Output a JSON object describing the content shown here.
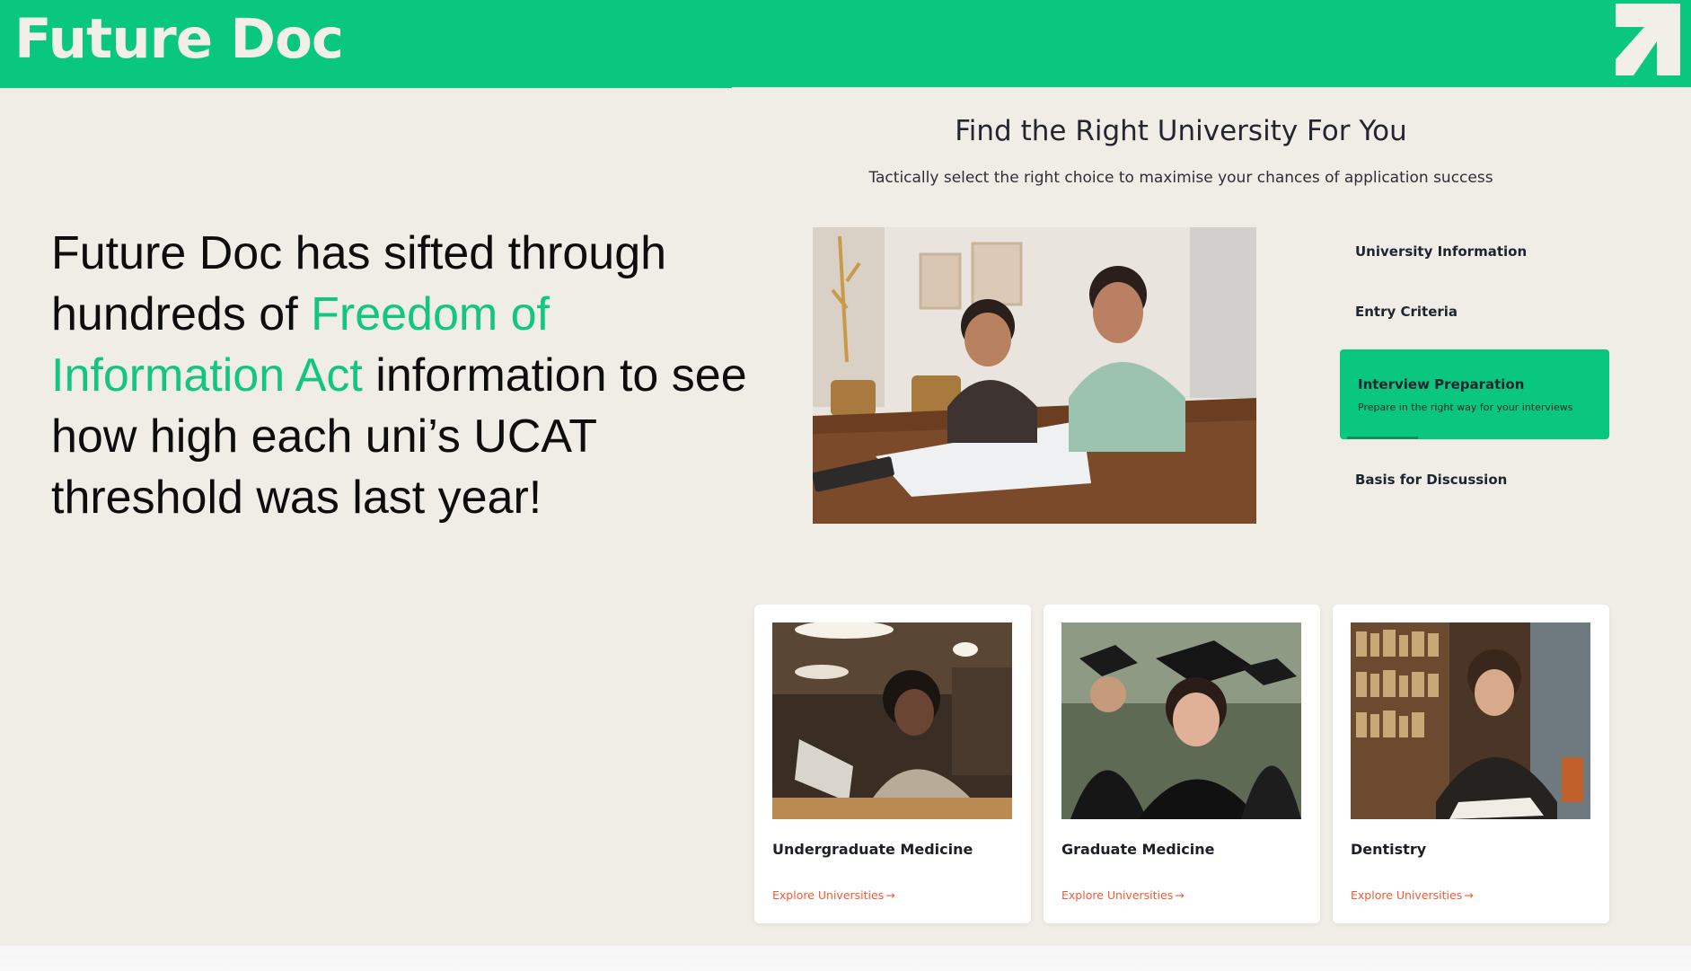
{
  "header": {
    "brand": "Future Doc",
    "logo_icon": "arrow-up-right-icon"
  },
  "hero": {
    "part1": "Future Doc has sifted through hundreds of ",
    "accent": "Freedom of Information Act",
    "part2": " information to see how high each uni’s UCAT threshold was last year!"
  },
  "section": {
    "title": "Find the Right University For You",
    "subtitle": "Tactically select the right choice to maximise your chances of application success"
  },
  "menu": {
    "items": [
      {
        "label": "University Information"
      },
      {
        "label": "Entry Criteria"
      },
      {
        "label": "Interview Preparation",
        "desc": "Prepare in the right way for your interviews",
        "active": true
      },
      {
        "label": "Basis for Discussion"
      }
    ]
  },
  "cards": [
    {
      "title": "Undergraduate Medicine",
      "link": "Explore Universities"
    },
    {
      "title": "Graduate Medicine",
      "link": "Explore Universities"
    },
    {
      "title": "Dentistry",
      "link": "Explore Universities"
    }
  ],
  "colors": {
    "brand_green": "#09c77f",
    "accent_green": "#12c680",
    "link_orange": "#ef5b34",
    "page_bg": "#f0ede6"
  }
}
